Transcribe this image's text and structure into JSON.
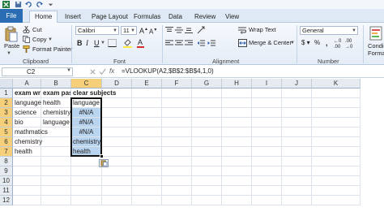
{
  "app": {
    "file_tab": "File",
    "tabs": [
      "Home",
      "Insert",
      "Page Layout",
      "Formulas",
      "Data",
      "Review",
      "View"
    ]
  },
  "ribbon": {
    "clipboard": {
      "paste": "Paste",
      "cut": "Cut",
      "copy": "Copy",
      "format_painter": "Format Painter",
      "group_label": "Clipboard"
    },
    "font": {
      "font_name": "Calibri",
      "font_size": "11",
      "group_label": "Font"
    },
    "alignment": {
      "wrap_text": "Wrap Text",
      "merge_center": "Merge & Center",
      "group_label": "Alignment"
    },
    "number": {
      "format": "General",
      "group_label": "Number"
    },
    "styles": {
      "conditional_formatting_line1": "Condi",
      "conditional_formatting_line2": "Forma"
    }
  },
  "formula_bar": {
    "name_box": "C2",
    "fx": "fx",
    "formula": "=VLOOKUP(A2,$B$2:$B$4,1,0)"
  },
  "sheet": {
    "columns": [
      "A",
      "B",
      "C",
      "D",
      "E",
      "F",
      "G",
      "H",
      "I",
      "J",
      "K"
    ],
    "selected_column": "C",
    "rows": [
      "1",
      "2",
      "3",
      "4",
      "5",
      "6",
      "7",
      "8",
      "9",
      "10",
      "11",
      "12"
    ],
    "selected_rows": [
      "2",
      "3",
      "4",
      "5",
      "6",
      "7"
    ],
    "cells": {
      "A1": "exam writ",
      "B1": "exam pas",
      "C1": "clear subjects",
      "A2": "language",
      "B2": "health",
      "C2": "language",
      "A3": "science",
      "B3": "chemistry",
      "C3": "#N/A",
      "A4": "bio",
      "B4": "language",
      "C4": "#N/A",
      "A5": "mathmatics",
      "C5": "#N/A",
      "A6": "chemistry",
      "C6": "chemistry",
      "A7": "health",
      "C7": "health"
    }
  }
}
